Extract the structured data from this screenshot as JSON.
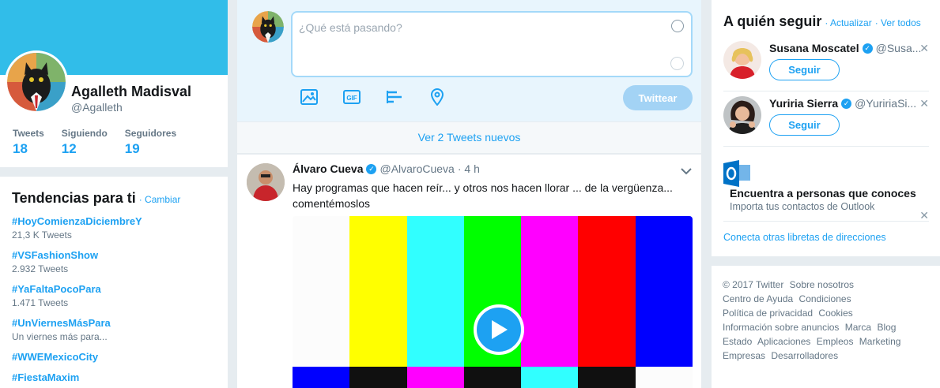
{
  "profile": {
    "name": "Agalleth Madisval",
    "handle": "@Agalleth",
    "stats": [
      {
        "label": "Tweets",
        "value": "18"
      },
      {
        "label": "Siguiendo",
        "value": "12"
      },
      {
        "label": "Seguidores",
        "value": "19"
      }
    ],
    "colors": {
      "banner": "#31bde9"
    }
  },
  "trends": {
    "title": "Tendencias para ti",
    "change_link": "· Cambiar",
    "items": [
      {
        "name": "#HoyComienzaDiciembreY",
        "meta": "21,3 K Tweets"
      },
      {
        "name": "#VSFashionShow",
        "meta": "2.932 Tweets"
      },
      {
        "name": "#YaFaltaPocoPara",
        "meta": "1.471 Tweets"
      },
      {
        "name": "#UnViernesMásPara",
        "meta": "Un viernes más para..."
      },
      {
        "name": "#WWEMexicoCity",
        "meta": ""
      },
      {
        "name": "#FiestaMaxim",
        "meta": ""
      }
    ]
  },
  "composer": {
    "placeholder": "¿Qué está pasando?",
    "tweet_button": "Twittear",
    "tools": [
      "image-icon",
      "gif-icon",
      "poll-icon",
      "location-icon"
    ]
  },
  "new_tweets_bar": "Ver 2 Tweets nuevos",
  "tweet": {
    "name": "Álvaro Cueva",
    "handle": "@AlvaroCueva",
    "time": "· 4 h",
    "text": "Hay programas que hacen reír... y otros nos hacen llorar ... de la vergüenza... comentémoslos",
    "media_colors_top": [
      "#fcfcfc",
      "#ffff00",
      "#31ffff",
      "#00ff00",
      "#ff00ff",
      "#ff0000",
      "#0000ff"
    ],
    "media_colors_bottom": [
      "#0000ff",
      "#101010",
      "#ff00ff",
      "#101010",
      "#31ffff",
      "#101010",
      "#fcfcfc"
    ]
  },
  "who_to_follow": {
    "title": "A quién seguir",
    "refresh_link": "· Actualizar",
    "view_all_link": "· Ver todos",
    "users": [
      {
        "name": "Susana Moscatel",
        "handle": "@Susa...",
        "follow": "Seguir"
      },
      {
        "name": "Yuriria Sierra",
        "handle": "@YuririaSi...",
        "follow": "Seguir"
      }
    ],
    "outlook": {
      "title": "Encuentra a personas que conoces",
      "subtitle": "Importa tus contactos de Outlook"
    },
    "connect_link": "Conecta otras libretas de direcciones"
  },
  "footer": {
    "links": [
      "© 2017 Twitter",
      "Sobre nosotros",
      "Centro de Ayuda",
      "Condiciones",
      "Política de privacidad",
      "Cookies",
      "Información sobre anuncios",
      "Marca",
      "Blog",
      "Estado",
      "Aplicaciones",
      "Empleos",
      "Marketing",
      "Empresas",
      "Desarrolladores"
    ]
  }
}
